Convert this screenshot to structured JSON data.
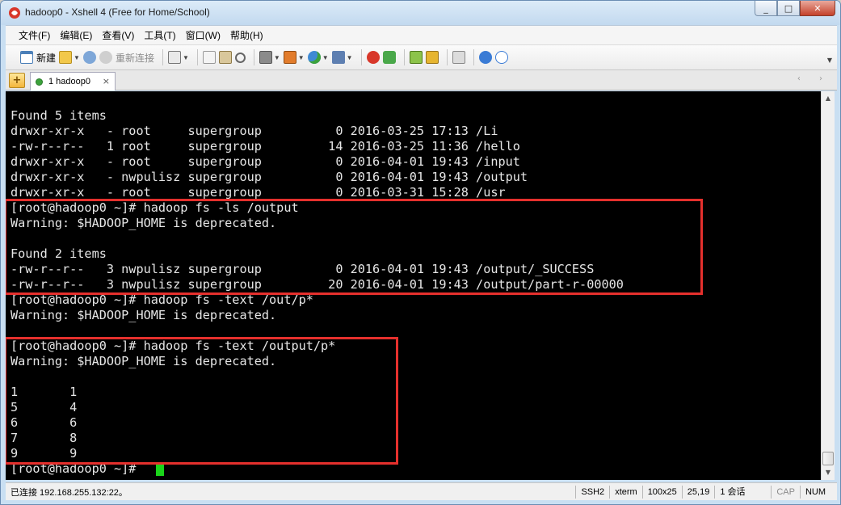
{
  "window": {
    "title": "hadoop0 - Xshell 4 (Free for Home/School)",
    "controls": [
      "_",
      "□",
      "✕"
    ]
  },
  "menu": {
    "items": [
      "文件(F)",
      "编辑(E)",
      "查看(V)",
      "工具(T)",
      "窗口(W)",
      "帮助(H)"
    ]
  },
  "toolbar": {
    "new_label": "新建",
    "reconnect_label": "重新连接"
  },
  "tabs": {
    "add_label": "+",
    "items": [
      {
        "label": "1 hadoop0",
        "close": "×"
      }
    ],
    "nav": "‹ ›"
  },
  "terminal": {
    "lines": [
      "",
      "Found 5 items",
      "drwxr-xr-x   - root     supergroup          0 2016-03-25 17:13 /Li",
      "-rw-r--r--   1 root     supergroup         14 2016-03-25 11:36 /hello",
      "drwxr-xr-x   - root     supergroup          0 2016-04-01 19:43 /input",
      "drwxr-xr-x   - nwpulisz supergroup          0 2016-04-01 19:43 /output",
      "drwxr-xr-x   - root     supergroup          0 2016-03-31 15:28 /usr",
      "[root@hadoop0 ~]# hadoop fs -ls /output",
      "Warning: $HADOOP_HOME is deprecated.",
      "",
      "Found 2 items",
      "-rw-r--r--   3 nwpulisz supergroup          0 2016-04-01 19:43 /output/_SUCCESS",
      "-rw-r--r--   3 nwpulisz supergroup         20 2016-04-01 19:43 /output/part-r-00000",
      "[root@hadoop0 ~]# hadoop fs -text /out/p*",
      "Warning: $HADOOP_HOME is deprecated.",
      "",
      "[root@hadoop0 ~]# hadoop fs -text /output/p*",
      "Warning: $HADOOP_HOME is deprecated.",
      "",
      "1       1",
      "5       4",
      "6       6",
      "7       8",
      "9       9",
      "[root@hadoop0 ~]# "
    ],
    "colors": {
      "background": "#000000",
      "text": "#e6e6e6",
      "cursor": "#1ad51a",
      "highlight": "#e5302d"
    }
  },
  "status": {
    "connection": "已连接 192.168.255.132:22。",
    "protocol": "SSH2",
    "terminal_type": "xterm",
    "size": "100x25",
    "cursor_pos": "25,19",
    "sessions": "1 会话",
    "caps": "CAP",
    "num": "NUM"
  }
}
